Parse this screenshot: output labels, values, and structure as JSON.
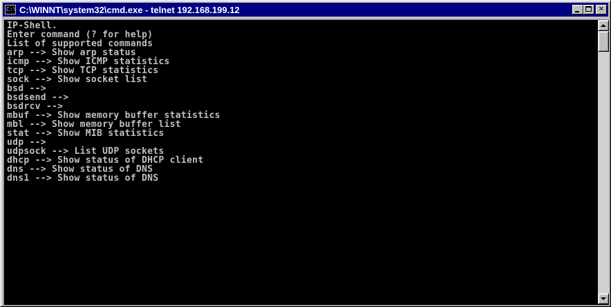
{
  "window": {
    "title": "C:\\WINNT\\system32\\cmd.exe - telnet 192.168.199.12",
    "icon": "cmd-icon",
    "icon_text": "C:\\",
    "buttons": {
      "minimize": "minimize-icon",
      "maximize": "maximize-icon",
      "close": "close-icon",
      "close_glyph": "✕"
    },
    "titlebar_color": "#000080"
  },
  "console": {
    "background": "#000000",
    "foreground": "#c0c0c0",
    "lines": [
      "IP-Shell.",
      "Enter command (? for help)",
      "List of supported commands",
      "arp --> Show arp status",
      "icmp --> Show ICMP statistics",
      "tcp --> Show TCP statistics",
      "sock --> Show socket list",
      "bsd -->",
      "bsdsend -->",
      "bsdrcv -->",
      "mbuf --> Show memory buffer statistics",
      "mbl --> Show memory buffer list",
      "stat --> Show MIB statistics",
      "udp -->",
      "udpsock --> List UDP sockets",
      "dhcp --> Show status of DHCP client",
      "dns --> Show status of DNS",
      "dns1 --> Show status of DNS"
    ]
  },
  "scrollbar": {
    "up_icon": "scroll-up-arrow-icon",
    "down_icon": "scroll-down-arrow-icon"
  }
}
